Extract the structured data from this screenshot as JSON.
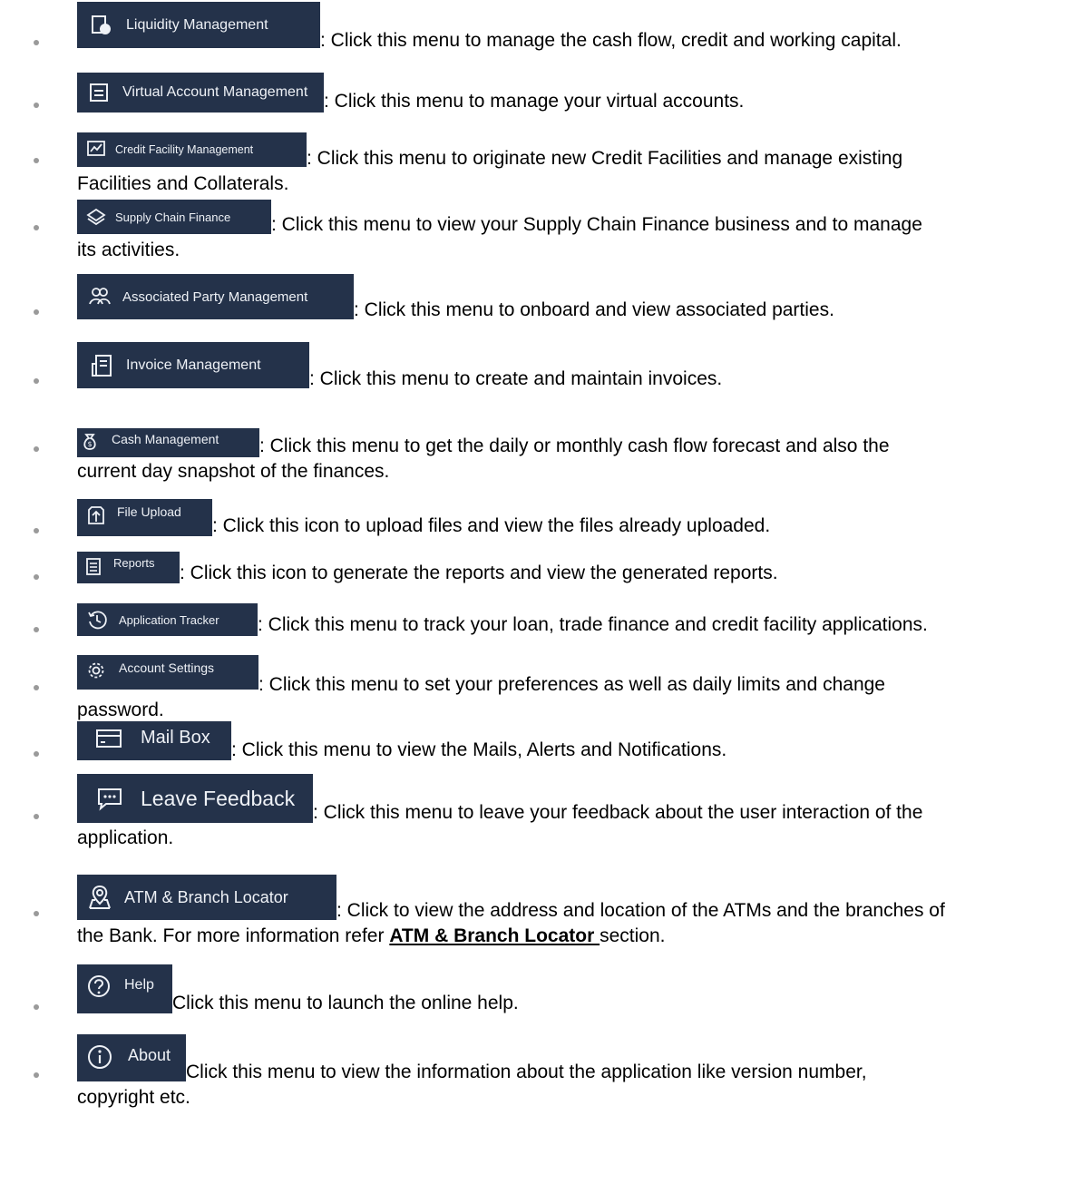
{
  "items": [
    {
      "menu": "Liquidity Management",
      "line1": ": Click this menu to manage the cash flow, credit and working capital.",
      "line2": "",
      "icon": "liquidity-icon"
    },
    {
      "menu": "Virtual Account Management",
      "line1": ": Click this menu to manage your virtual accounts.",
      "line2": "",
      "icon": "virtual-account-icon"
    },
    {
      "menu": "Credit Facility Management",
      "line1": ": Click this menu to originate new Credit Facilities and manage existing",
      "line2": "Facilities and Collaterals.",
      "icon": "chart-icon"
    },
    {
      "menu": "Supply Chain Finance",
      "line1": ":  Click this menu to view your Supply Chain Finance business and to manage",
      "line2": "its activities.",
      "icon": "layers-icon"
    },
    {
      "menu": "Associated Party Management",
      "line1": ": Click this menu to onboard and view associated parties.",
      "line2": "",
      "icon": "people-icon"
    },
    {
      "menu": "Invoice Management",
      "line1": ": Click this menu to create and maintain invoices.",
      "line2": "",
      "icon": "invoice-icon"
    },
    {
      "menu": "Cash Management",
      "line1": ": Click this menu to get the daily or monthly cash flow forecast and also the",
      "line2": "current day snapshot of the finances.",
      "icon": "money-bag-icon"
    },
    {
      "menu": "File Upload",
      "line1": ": Click this icon to upload files and view the files already uploaded.",
      "line2": "",
      "icon": "upload-icon"
    },
    {
      "menu": "Reports",
      "line1": ": Click this icon to generate the reports and view the generated reports.",
      "line2": "",
      "icon": "report-icon"
    },
    {
      "menu": "Application Tracker",
      "line1": ": Click this menu to track your loan, trade finance and credit facility applications.",
      "line2": "",
      "icon": "history-icon"
    },
    {
      "menu": "Account Settings",
      "line1": ": Click this menu to set your preferences as well as daily limits and change",
      "line2": "password.",
      "icon": "gear-icon"
    },
    {
      "menu": "Mail Box",
      "line1": ": Click this menu to view the Mails, Alerts and Notifications.",
      "line2": "",
      "icon": "mail-icon"
    },
    {
      "menu": "Leave Feedback",
      "line1": ": Click this menu to leave your feedback about the user interaction of the",
      "line2": "application.",
      "icon": "chat-icon"
    },
    {
      "menu": "ATM & Branch Locator",
      "line1": ": Click to view the address and location of the ATMs and the branches of",
      "line2_pre": "the Bank. For more information refer ",
      "line2_link": "ATM & Branch Locator ",
      "line2_post": "section.",
      "icon": "location-icon"
    },
    {
      "menu": "Help",
      "line1": " Click this menu to launch the online help.",
      "line2": "",
      "icon": "help-icon"
    },
    {
      "menu": "About",
      "line1": " Click this menu to view the information about the application like version number,",
      "line2": "copyright etc.",
      "icon": "info-icon"
    }
  ]
}
